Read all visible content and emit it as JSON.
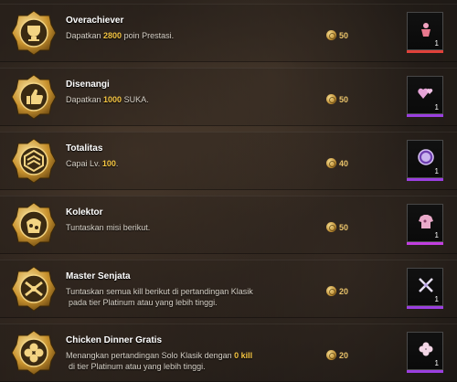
{
  "achievements": [
    {
      "title": "Overachiever",
      "desc_parts": [
        "Dapatkan ",
        "2800",
        " poin Prestasi."
      ],
      "points": "50",
      "reward_qty": "1",
      "badge_icon": "trophy",
      "reward_icon": "outfit",
      "rarity_color": "#e0413a"
    },
    {
      "title": "Disenangi",
      "desc_parts": [
        "Dapatkan ",
        "1000",
        " SUKA."
      ],
      "points": "50",
      "reward_qty": "1",
      "badge_icon": "thumbs-up",
      "reward_icon": "hearts",
      "rarity_color": "#9b3fe0"
    },
    {
      "title": "Totalitas",
      "desc_parts": [
        "Capai Lv. ",
        "100",
        "."
      ],
      "points": "40",
      "reward_qty": "1",
      "badge_icon": "chevrons",
      "reward_icon": "level-100",
      "rarity_color": "#9b3fe0"
    },
    {
      "title": "Kolektor",
      "desc_parts": [
        "Tuntaskan misi berikut.",
        "",
        ""
      ],
      "points": "50",
      "reward_qty": "1",
      "badge_icon": "bag",
      "reward_icon": "outfit",
      "rarity_color": "#c23fe0"
    },
    {
      "title": "Master Senjata",
      "desc_line1": "Tuntaskan semua kill berikut di pertandingan Klasik",
      "desc_line2": "pada tier Platinum atau yang lebih tinggi.",
      "points": "20",
      "reward_qty": "1",
      "badge_icon": "crossed-guns",
      "reward_icon": "crossed-swords",
      "rarity_color": "#9b3fe0"
    },
    {
      "title": "Chicken Dinner Gratis",
      "desc_line1_parts": [
        "Menangkan pertandingan Solo Klasik dengan ",
        "0 kill"
      ],
      "desc_line2": "di tier Platinum atau yang lebih tinggi.",
      "points": "20",
      "reward_qty": "1",
      "badge_icon": "clover",
      "reward_icon": "clover",
      "rarity_color": "#9b3fe0"
    }
  ]
}
